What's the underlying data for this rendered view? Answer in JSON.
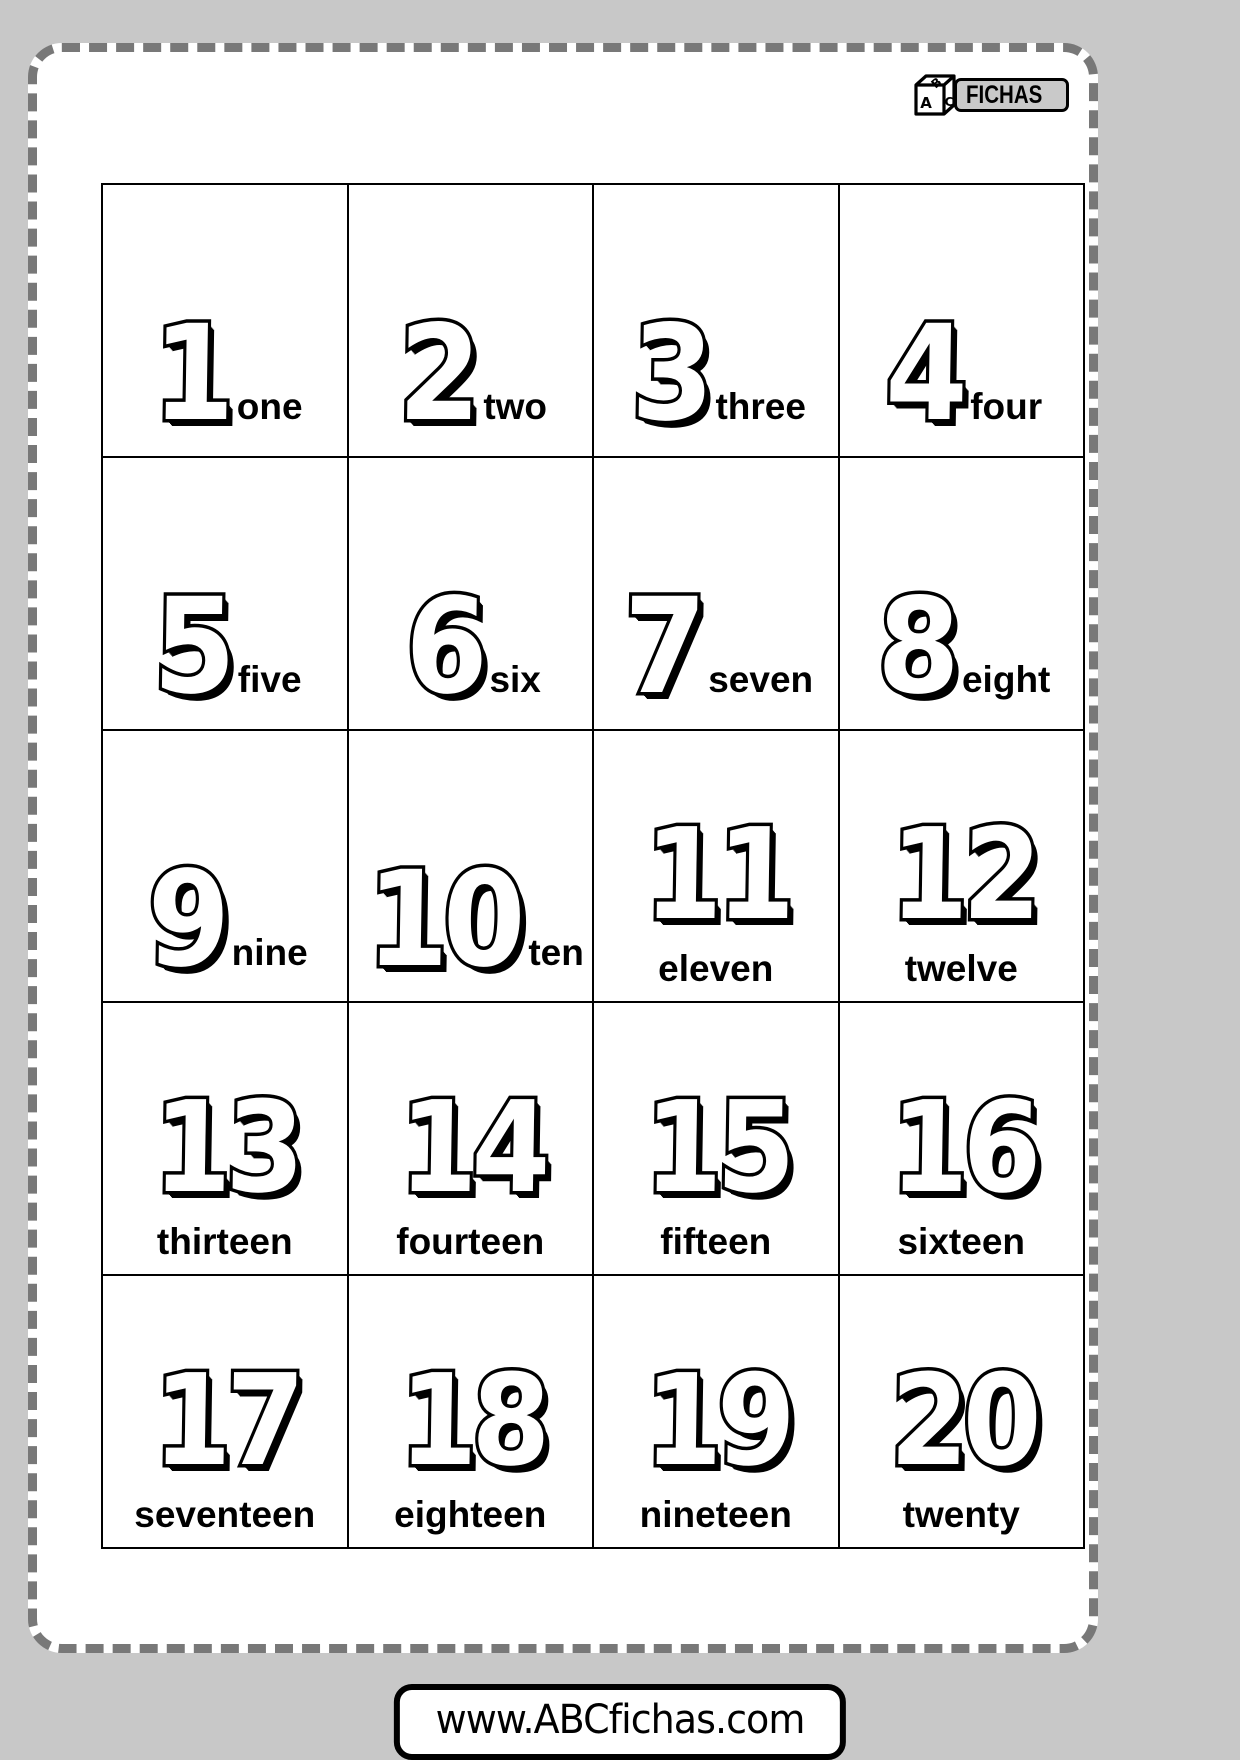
{
  "page": {
    "background_color": "#c8c8c8",
    "sheet_color": "#ffffff",
    "border_color": "#787878"
  },
  "logo": {
    "cube_letters": [
      "A",
      "B",
      "C"
    ],
    "wordmark": "FICHAS",
    "wordmark_bg": "#c9c9c9"
  },
  "footer": {
    "url": "www.ABCfichas.com"
  },
  "grid": {
    "rows": 5,
    "columns": 4,
    "cells": [
      {
        "numeral": "1",
        "word": "one",
        "label_position": "inline"
      },
      {
        "numeral": "2",
        "word": "two",
        "label_position": "inline"
      },
      {
        "numeral": "3",
        "word": "three",
        "label_position": "inline"
      },
      {
        "numeral": "4",
        "word": "four",
        "label_position": "inline"
      },
      {
        "numeral": "5",
        "word": "five",
        "label_position": "inline"
      },
      {
        "numeral": "6",
        "word": "six",
        "label_position": "inline"
      },
      {
        "numeral": "7",
        "word": "seven",
        "label_position": "inline"
      },
      {
        "numeral": "8",
        "word": "eight",
        "label_position": "inline"
      },
      {
        "numeral": "9",
        "word": "nine",
        "label_position": "inline"
      },
      {
        "numeral": "10",
        "word": "ten",
        "label_position": "inline"
      },
      {
        "numeral": "11",
        "word": "eleven",
        "label_position": "below"
      },
      {
        "numeral": "12",
        "word": "twelve",
        "label_position": "below"
      },
      {
        "numeral": "13",
        "word": "thirteen",
        "label_position": "below"
      },
      {
        "numeral": "14",
        "word": "fourteen",
        "label_position": "below"
      },
      {
        "numeral": "15",
        "word": "fifteen",
        "label_position": "below"
      },
      {
        "numeral": "16",
        "word": "sixteen",
        "label_position": "below"
      },
      {
        "numeral": "17",
        "word": "seventeen",
        "label_position": "below"
      },
      {
        "numeral": "18",
        "word": "eighteen",
        "label_position": "below"
      },
      {
        "numeral": "19",
        "word": "nineteen",
        "label_position": "below"
      },
      {
        "numeral": "20",
        "word": "twenty",
        "label_position": "below"
      }
    ]
  }
}
